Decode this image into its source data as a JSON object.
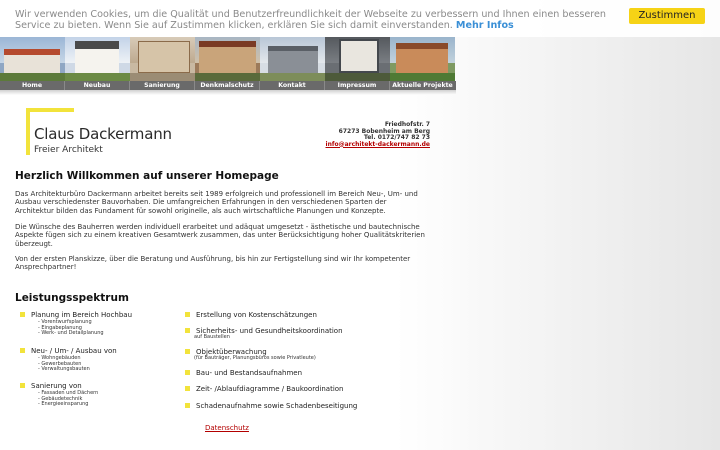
{
  "cookie": {
    "text": "Wir verwenden Cookies, um die Qualität und Benutzerfreundlichkeit der Webseite zu verbessern und Ihnen einen besseren Service zu bieten. Wenn Sie auf Zustimmen klicken, erklären Sie sich damit einverstanden.",
    "more_link": "Mehr Infos",
    "accept_label": "Zustimmen"
  },
  "nav": {
    "items": [
      "Home",
      "Neubau",
      "Sanierung",
      "Denkmalschutz",
      "Kontakt",
      "Impressum",
      "Aktuelle Projekte"
    ]
  },
  "logo": {
    "name": "Claus Dackermann",
    "subtitle": "Freier Architekt"
  },
  "address": {
    "street": "Friedhofstr. 7",
    "city": "67273 Bobenheim am Berg",
    "phone": "Tel. 0172/747 82 73",
    "email": "info@architekt-dackermann.de"
  },
  "main": {
    "heading": "Herzlich Willkommen auf unserer Homepage",
    "paragraphs": [
      "Das Architekturbüro Dackermann arbeitet bereits seit 1989 erfolgreich und professionell im Bereich Neu-, Um- und Ausbau verschiedenster Bauvorhaben. Die umfangreichen Erfahrungen in den verschiedenen Sparten der Architektur bilden das Fundament für sowohl originelle, als auch wirtschaftliche Planungen und Konzepte.",
      "Die Wünsche des Bauherren werden individuell erarbeitet und adäquat umgesetzt - ästhetische und bautechnische Aspekte fügen sich zu einem kreativen Gesamtwerk zusammen, das unter Berücksichtigung hoher Qualitätskriterien überzeugt.",
      "Von der ersten Planskizze, über die Beratung und Ausführung, bis hin zur Fertigstellung sind wir Ihr kompetenter Ansprechpartner!"
    ]
  },
  "services": {
    "heading": "Leistungsspektrum",
    "left": [
      {
        "label": "Planung im Bereich Hochbau",
        "subs": [
          "- Vorentwurfsplanung",
          "- Eingabeplanung",
          "- Werk- und Detailplanung"
        ]
      },
      {
        "label": "Neu- / Um- / Ausbau von",
        "subs": [
          "- Wohngebäuden",
          "- Gewerbebauten",
          "- Verwaltungsbauten"
        ]
      },
      {
        "label": "Sanierung von",
        "subs": [
          "- Fassaden und Dächern",
          "- Gebäudetechnik",
          "- Energieeinsparung"
        ]
      }
    ],
    "right": [
      {
        "label": "Erstellung von Kostenschätzungen",
        "note": ""
      },
      {
        "label": "Sicherheits- und Gesundheitskoordination",
        "note": "auf Baustellen"
      },
      {
        "label": "Objektüberwachung",
        "note": "(für Bauträger, Planungsbüros sowie Privatleute)"
      },
      {
        "label": "Bau- und Bestandsaufnahmen",
        "note": ""
      },
      {
        "label": "Zeit- /Ablaufdiagramme / Baukoordination",
        "note": ""
      },
      {
        "label": "Schadenaufnahme sowie Schadenbeseitigung",
        "note": ""
      }
    ]
  },
  "footer": {
    "privacy_link": "Datenschutz"
  },
  "colors": {
    "accent_yellow": "#f2e33b",
    "nav_gray": "#6a6a6a",
    "link_red": "#b30000",
    "cookie_button": "#f6d316",
    "cookie_link": "#3a8fd6"
  }
}
